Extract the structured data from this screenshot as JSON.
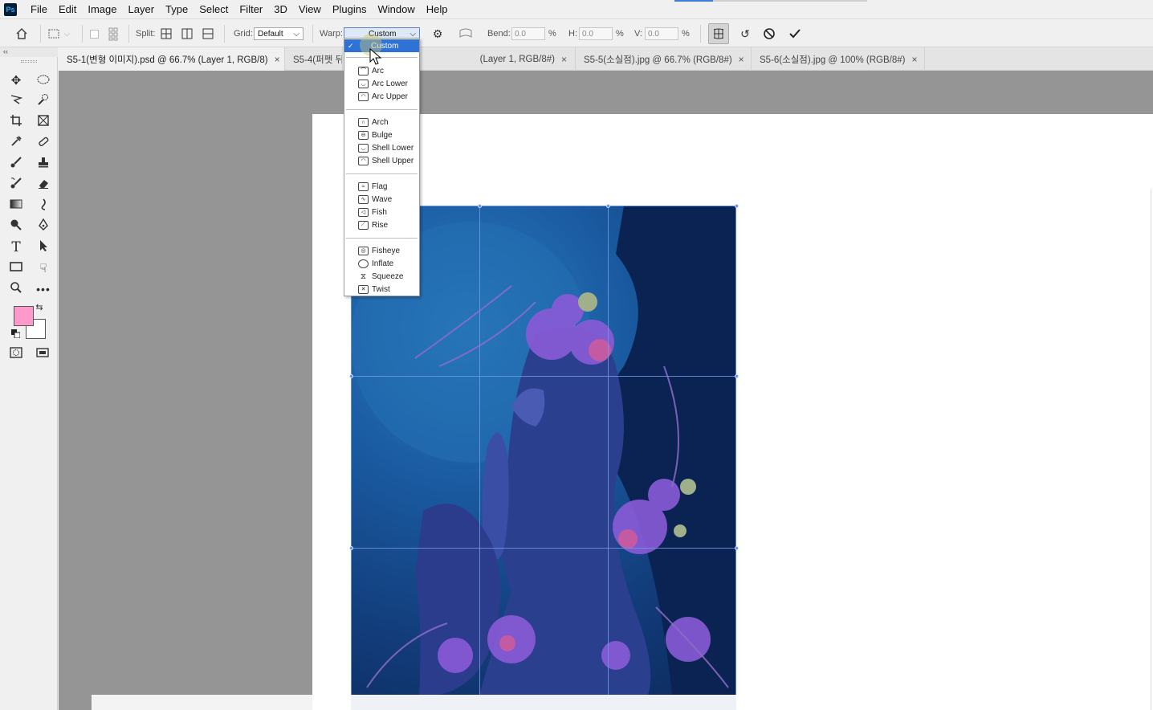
{
  "app": {
    "logo": "Ps"
  },
  "menu": [
    "File",
    "Edit",
    "Image",
    "Layer",
    "Type",
    "Select",
    "Filter",
    "3D",
    "View",
    "Plugins",
    "Window",
    "Help"
  ],
  "options": {
    "split_label": "Split:",
    "grid_label": "Grid:",
    "grid_value": "Default",
    "warp_label": "Warp:",
    "warp_value": "Custom",
    "bend_label": "Bend:",
    "bend_value": "0.0",
    "h_label": "H:",
    "h_value": "0.0",
    "v_label": "V:",
    "v_value": "0.0",
    "percent": "%"
  },
  "toolbar": {
    "collapse_glyph": "‹‹"
  },
  "tabs": [
    {
      "label": "S5-1(변형 이미지).psd @ 66.7% (Layer 1, RGB/8)",
      "close": "×"
    },
    {
      "label": "S5-4(퍼펫 뒤",
      "close": ""
    },
    {
      "label": "(Layer 1, RGB/8#)",
      "close": "×"
    },
    {
      "label": "S5-5(소실점).jpg @ 66.7% (RGB/8#)",
      "close": "×"
    },
    {
      "label": "S5-6(소실점).jpg @ 100% (RGB/8#)",
      "close": "×"
    }
  ],
  "colors": {
    "foreground": "#ff99cc",
    "background": "#ffffff",
    "accent": "#2f72d6"
  },
  "warp_dropdown": {
    "check": "✓",
    "items": [
      {
        "label": "Custom",
        "icon": "",
        "selected": true
      },
      {
        "label": "Arc",
        "icon": "arc-icon"
      },
      {
        "label": "Arc Lower",
        "icon": "arc-lower-icon"
      },
      {
        "label": "Arc Upper",
        "icon": "arc-upper-icon"
      },
      {
        "label": "Arch",
        "icon": "arch-icon"
      },
      {
        "label": "Bulge",
        "icon": "bulge-icon"
      },
      {
        "label": "Shell Lower",
        "icon": "shell-lower-icon"
      },
      {
        "label": "Shell Upper",
        "icon": "shell-upper-icon"
      },
      {
        "label": "Flag",
        "icon": "flag-icon"
      },
      {
        "label": "Wave",
        "icon": "wave-icon"
      },
      {
        "label": "Fish",
        "icon": "fish-icon"
      },
      {
        "label": "Rise",
        "icon": "rise-icon"
      },
      {
        "label": "Fisheye",
        "icon": "fisheye-icon"
      },
      {
        "label": "Inflate",
        "icon": "inflate-icon"
      },
      {
        "label": "Squeeze",
        "icon": "squeeze-icon"
      },
      {
        "label": "Twist",
        "icon": "twist-icon"
      }
    ]
  }
}
